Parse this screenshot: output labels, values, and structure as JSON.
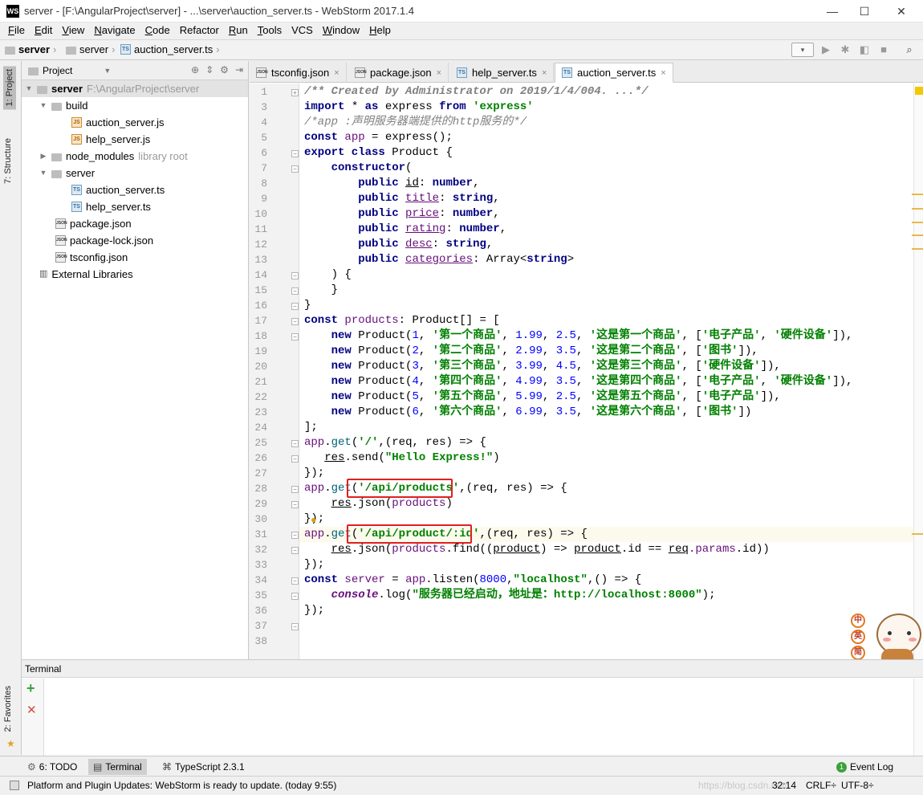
{
  "window": {
    "title": "server - [F:\\AngularProject\\server] - ...\\server\\auction_server.ts - WebStorm 2017.1.4",
    "logo": "WS",
    "min": "—",
    "max": "☐",
    "close": "✕"
  },
  "menu": [
    {
      "u": "F",
      "rest": "ile"
    },
    {
      "u": "E",
      "rest": "dit"
    },
    {
      "u": "V",
      "rest": "iew"
    },
    {
      "u": "N",
      "rest": "avigate"
    },
    {
      "u": "C",
      "rest": "ode"
    },
    {
      "u": "",
      "rest": "Refactor"
    },
    {
      "u": "R",
      "rest": "un"
    },
    {
      "u": "T",
      "rest": "ools"
    },
    {
      "u": "",
      "rest": "VCS"
    },
    {
      "u": "W",
      "rest": "indow"
    },
    {
      "u": "H",
      "rest": "elp"
    }
  ],
  "breadcrumb": {
    "root": "server",
    "folder": "server",
    "file": "auction_server.ts"
  },
  "left_strip": {
    "project": "1: Project",
    "structure": "7: Structure",
    "favorites": "2: Favorites"
  },
  "project_panel": {
    "header": "Project",
    "root_name": "server",
    "root_path": "F:\\AngularProject\\server",
    "items": {
      "build": "build",
      "build_auction": "auction_server.js",
      "build_help": "help_server.js",
      "node_modules": "node_modules",
      "node_modules_note": "library root",
      "server": "server",
      "server_auction": "auction_server.ts",
      "server_help": "help_server.ts",
      "package": "package.json",
      "package_lock": "package-lock.json",
      "tsconfig": "tsconfig.json",
      "external": "External Libraries"
    }
  },
  "tabs": {
    "t1": "tsconfig.json",
    "t2": "package.json",
    "t3": "help_server.ts",
    "t4": "auction_server.ts"
  },
  "line_numbers": [
    "1",
    "3",
    "4",
    "5",
    "6",
    "7",
    "8",
    "9",
    "10",
    "11",
    "12",
    "13",
    "14",
    "15",
    "16",
    "17",
    "18",
    "19",
    "20",
    "21",
    "22",
    "23",
    "24",
    "25",
    "26",
    "27",
    "28",
    "29",
    "30",
    "31",
    "32",
    "33",
    "34",
    "35",
    "36",
    "37",
    "38"
  ],
  "code": {
    "l1": "/** Created by Administrator on 2019/1/4/004. ...*/",
    "l3_a": "import",
    "l3_b": " * ",
    "l3_c": "as",
    "l3_d": " express ",
    "l3_e": "from",
    "l3_f": "'express'",
    "l4": "/*app :声明服务器端提供的http服务的*/",
    "l5_a": "const",
    "l5_b": "app",
    "l5_c": " = express();",
    "l6_a": "export class",
    "l6_b": " Product {",
    "l7": "constructor",
    "l7_b": "(",
    "l8_a": "public",
    "l8_b": "id",
    "l8_c": ": ",
    "l8_d": "number",
    "l8_e": ",",
    "l9_b": "title",
    "l9_d": "string",
    "l10_b": "price",
    "l11_b": "rating",
    "l12_b": "desc",
    "l13_b": "categories",
    "l13_c": ": Array<",
    "l13_e": ">",
    "l14": ") {",
    "l15": "}",
    "l16": "}",
    "l17_a": "const",
    "l17_b": "products",
    "l17_c": ": Product[] = [",
    "new": "new",
    "l18": [
      " Product(",
      "1",
      ", ",
      "'第一个商品'",
      ", ",
      "1.99",
      ", ",
      "2.5",
      ", ",
      "'这是第一个商品'",
      ", [",
      "'电子产品'",
      ", ",
      "'硬件设备'",
      "]),"
    ],
    "l19": [
      " Product(",
      "2",
      ", ",
      "'第二个商品'",
      ", ",
      "2.99",
      ", ",
      "3.5",
      ", ",
      "'这是第二个商品'",
      ", [",
      "'图书'",
      "]),"
    ],
    "l20": [
      " Product(",
      "3",
      ", ",
      "'第三个商品'",
      ", ",
      "3.99",
      ", ",
      "4.5",
      ", ",
      "'这是第三个商品'",
      ", [",
      "'硬件设备'",
      "]),"
    ],
    "l21": [
      " Product(",
      "4",
      ", ",
      "'第四个商品'",
      ", ",
      "4.99",
      ", ",
      "3.5",
      ", ",
      "'这是第四个商品'",
      ", [",
      "'电子产品'",
      ", ",
      "'硬件设备'",
      "]),"
    ],
    "l22": [
      " Product(",
      "5",
      ", ",
      "'第五个商品'",
      ", ",
      "5.99",
      ", ",
      "2.5",
      ", ",
      "'这是第五个商品'",
      ", [",
      "'电子产品'",
      "]),"
    ],
    "l23": [
      " Product(",
      "6",
      ", ",
      "'第六个商品'",
      ", ",
      "6.99",
      ", ",
      "3.5",
      ", ",
      "'这是第六个商品'",
      ", [",
      "'图书'",
      "])"
    ],
    "l24": "];",
    "app": "app",
    "get": "get",
    "l25_str": "'/'",
    "l25_rest": ",(req, res) => {",
    "l26_a": "res",
    "l26_b": ".send(",
    "l26_c": "\"Hello Express!\"",
    "l26_d": ")",
    "close_fn": "});",
    "l28_str": "'/api/products'",
    "l28_rest": ",(req, res) => {",
    "l29_c": ".json(",
    "l29_d": "products",
    "l29_e": ")",
    "l31_str": "'/api/product/:id'",
    "l32_b": "products",
    "l32_c": ".find((",
    "l32_d": "product",
    "l32_e": ") => ",
    "l32_f": "product",
    "l32_g": ".id == ",
    "l32_h": "req",
    "l32_i": ".params",
    "l32_j": ".id))",
    "l34_a": "const",
    "l34_b": "server",
    "l34_c": " = ",
    "l34_d": "app",
    "l34_e": ".listen(",
    "l34_f": "8000",
    "l34_g": ",",
    "l34_h": "\"localhost\"",
    "l34_i": ",() => {",
    "l35_a": "console",
    "l35_b": ".log(",
    "l35_c": "\"服务器已经启动，地址是：http://localhost:8000\"",
    "l35_d": ");"
  },
  "terminal": {
    "title": "Terminal",
    "add": "+",
    "close": "✕"
  },
  "bottom_tabs": {
    "todo": "6: TODO",
    "terminal": "Terminal",
    "typescript": "TypeScript 2.3.1",
    "event_log": "Event Log"
  },
  "status": {
    "message": "Platform and Plugin Updates: WebStorm is ready to update. (today 9:55)",
    "position": "32:14",
    "line_sep": "CRLF÷",
    "encoding": "UTF-8÷",
    "watermark": "https://blog.csdn.net/"
  },
  "mascot_text": [
    "中",
    "英",
    "简"
  ]
}
